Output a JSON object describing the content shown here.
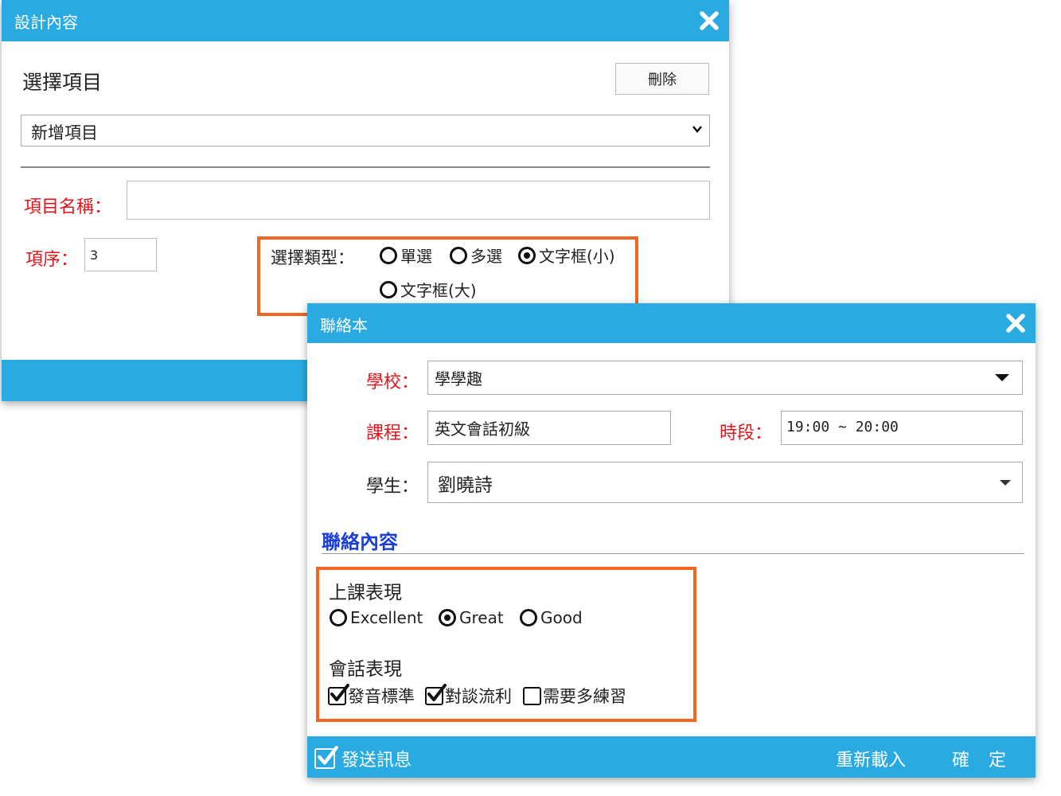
{
  "dialog1": {
    "title": "設計內容",
    "heading": "選擇項目",
    "delete_label": "刪除",
    "select_value": "新增項目",
    "name_label": "項目名稱：",
    "name_value": "",
    "order_label": "項序：",
    "order_value": "3",
    "type_label": "選擇類型：",
    "type_options": [
      "單選",
      "多選",
      "文字框(小)",
      "文字框(大)"
    ],
    "type_selected": "文字框(小)"
  },
  "dialog2": {
    "title": "聯絡本",
    "school_label": "學校：",
    "school_value": "學學趣",
    "course_label": "課程：",
    "course_value": "英文會話初級",
    "time_label": "時段：",
    "time_value": "19:00 ~ 20:00",
    "student_label": "學生：",
    "student_value": "劉曉詩",
    "section_title": "聯絡內容",
    "perf_title": "上課表現",
    "perf_options": [
      "Excellent",
      "Great",
      "Good"
    ],
    "perf_selected": "Great",
    "talk_title": "會話表現",
    "talk_options": [
      "發音標準",
      "對談流利",
      "需要多練習"
    ],
    "talk_checked": [
      true,
      true,
      false
    ],
    "footer": {
      "send_label": "發送訊息",
      "send_checked": true,
      "reload_label": "重新載入",
      "ok_label": "確　定"
    }
  },
  "colors": {
    "titlebar": "#29abe2",
    "highlight": "#f26522",
    "required_label": "#e0151b",
    "section_title": "#1a3fd6"
  }
}
